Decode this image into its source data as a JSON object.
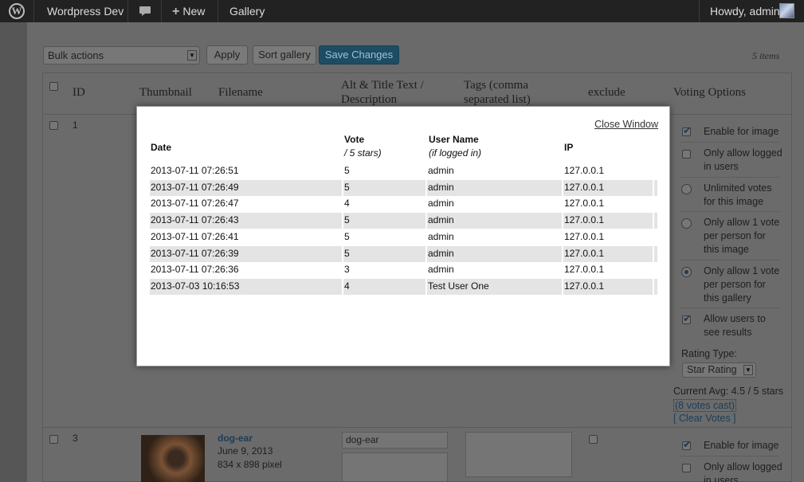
{
  "admin_bar": {
    "site_name": "Wordpress Dev",
    "new_label": "New",
    "gallery_label": "Gallery",
    "howdy": "Howdy, admin"
  },
  "toolbar": {
    "bulk_actions": "Bulk actions",
    "apply": "Apply",
    "sort_gallery": "Sort gallery",
    "save_changes": "Save Changes",
    "items_count": "5 items"
  },
  "table_headers": {
    "id": "ID",
    "thumbnail": "Thumbnail",
    "filename": "Filename",
    "alt_line1": "Alt & Title Text /",
    "alt_line2": "Description",
    "tags_line1": "Tags (comma",
    "tags_line2": "separated list)",
    "exclude": "exclude",
    "voting_options": "Voting Options"
  },
  "row1": {
    "id": "1"
  },
  "row3": {
    "id": "3",
    "filename": "dog-ear",
    "date": "June 9, 2013",
    "size": "834 x 898 pixel",
    "alt_text": "dog-ear"
  },
  "voting_options": {
    "enable_for_image": "Enable for image",
    "only_logged_in": "Only allow logged in users",
    "unlimited": "Unlimited votes for this image",
    "one_per_image": "Only allow 1 vote per person for this image",
    "one_per_gallery": "Only allow 1 vote per person for this gallery",
    "allow_see_results": "Allow users to see results",
    "rating_type_label": "Rating Type:",
    "rating_type_value": "Star Rating",
    "current_avg": "Current Avg: 4.5 / 5 stars",
    "votes_cast": "(8 votes cast)",
    "clear_votes": "[ Clear Votes ]"
  },
  "row3_options": {
    "enable_for_image": "Enable for image",
    "only_logged_in": "Only allow logged in users"
  },
  "modal": {
    "close": "Close Window",
    "headers": {
      "date": "Date",
      "vote": "Vote",
      "vote_sub": "/ 5 stars)",
      "user": "User Name",
      "user_sub": "(if logged in)",
      "ip": "IP"
    },
    "rows": [
      {
        "date": "2013-07-11 07:26:51",
        "vote": "5",
        "user": "admin",
        "ip": "127.0.0.1"
      },
      {
        "date": "2013-07-11 07:26:49",
        "vote": "5",
        "user": "admin",
        "ip": "127.0.0.1"
      },
      {
        "date": "2013-07-11 07:26:47",
        "vote": "4",
        "user": "admin",
        "ip": "127.0.0.1"
      },
      {
        "date": "2013-07-11 07:26:43",
        "vote": "5",
        "user": "admin",
        "ip": "127.0.0.1"
      },
      {
        "date": "2013-07-11 07:26:41",
        "vote": "5",
        "user": "admin",
        "ip": "127.0.0.1"
      },
      {
        "date": "2013-07-11 07:26:39",
        "vote": "5",
        "user": "admin",
        "ip": "127.0.0.1"
      },
      {
        "date": "2013-07-11 07:26:36",
        "vote": "3",
        "user": "admin",
        "ip": "127.0.0.1"
      },
      {
        "date": "2013-07-03 10:16:53",
        "vote": "4",
        "user": "Test User One",
        "ip": "127.0.0.1"
      }
    ]
  }
}
